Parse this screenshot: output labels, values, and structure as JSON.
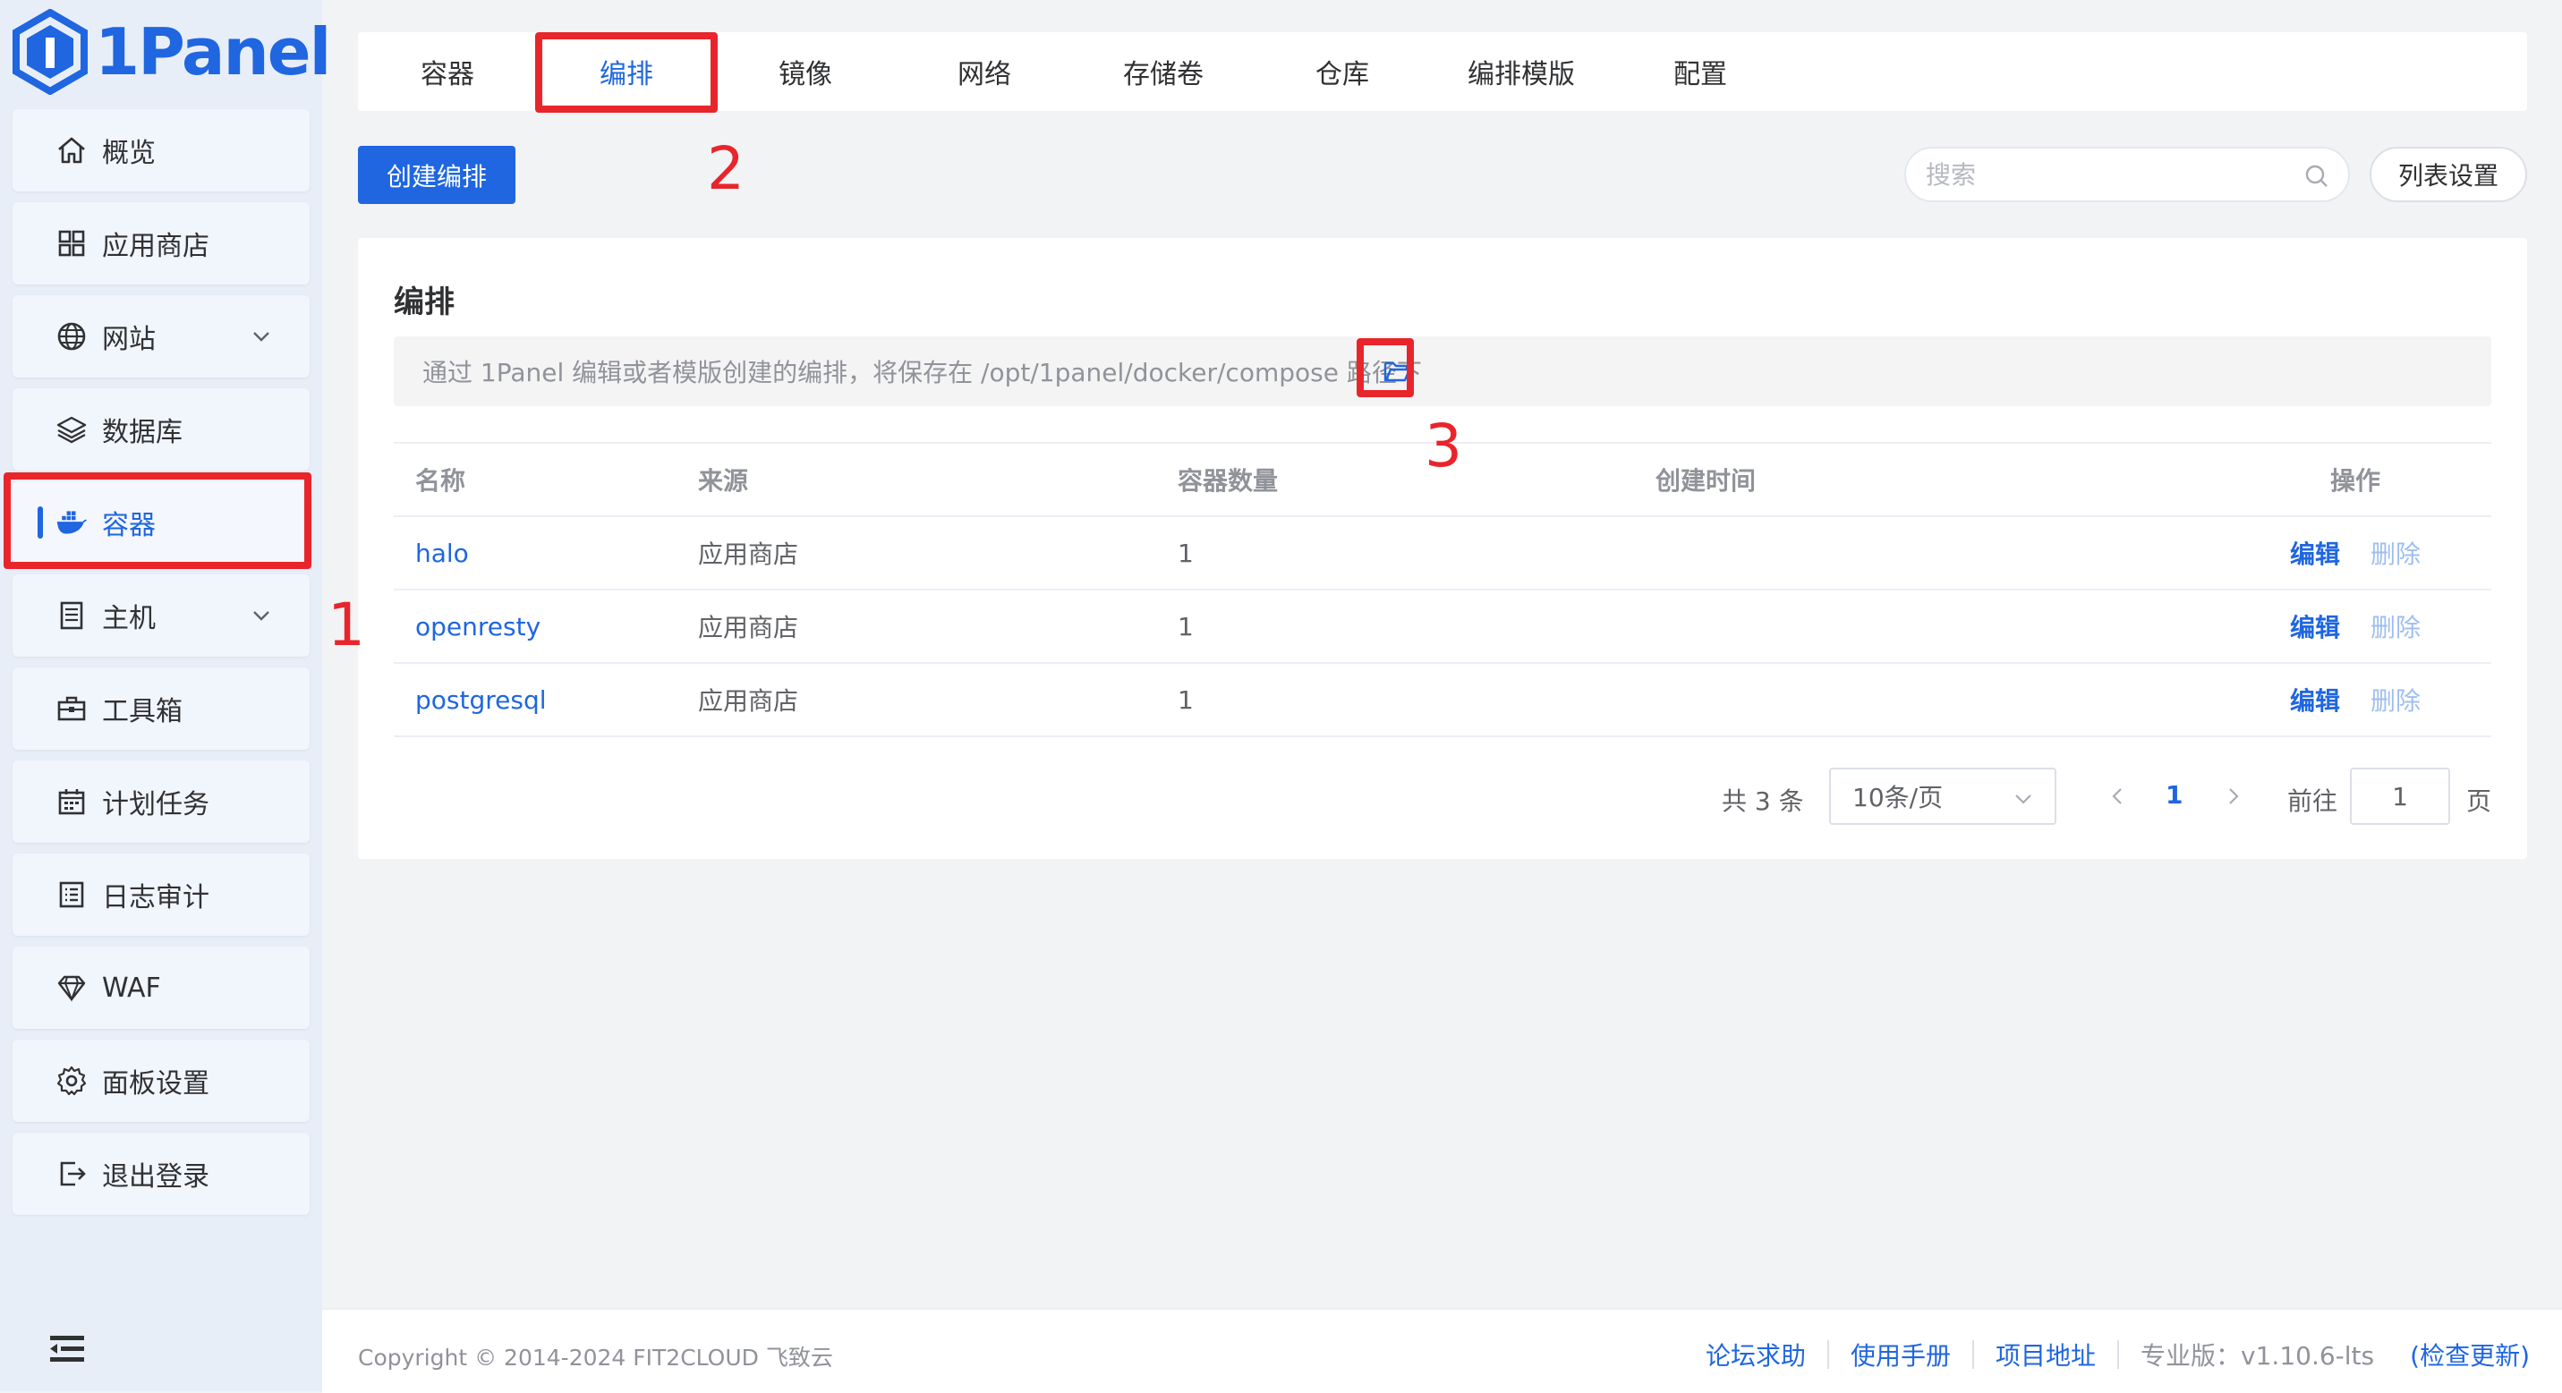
{
  "brand": {
    "name": "1Panel",
    "color": "#1f66e0"
  },
  "sidebar": {
    "items": [
      {
        "label": "概览",
        "icon": "home-icon"
      },
      {
        "label": "应用商店",
        "icon": "grid-icon"
      },
      {
        "label": "网站",
        "icon": "globe-icon",
        "expandable": true
      },
      {
        "label": "数据库",
        "icon": "layers-icon"
      },
      {
        "label": "容器",
        "icon": "docker-icon",
        "active": true
      },
      {
        "label": "主机",
        "icon": "server-icon",
        "expandable": true
      },
      {
        "label": "工具箱",
        "icon": "toolbox-icon"
      },
      {
        "label": "计划任务",
        "icon": "calendar-icon"
      },
      {
        "label": "日志审计",
        "icon": "log-icon"
      },
      {
        "label": "WAF",
        "icon": "diamond-icon"
      },
      {
        "label": "面板设置",
        "icon": "gear-icon"
      },
      {
        "label": "退出登录",
        "icon": "logout-icon"
      }
    ]
  },
  "tabs": [
    {
      "label": "容器"
    },
    {
      "label": "编排",
      "active": true
    },
    {
      "label": "镜像"
    },
    {
      "label": "网络"
    },
    {
      "label": "存储卷"
    },
    {
      "label": "仓库"
    },
    {
      "label": "编排模版"
    },
    {
      "label": "配置"
    }
  ],
  "toolbar": {
    "create_label": "创建编排",
    "search_placeholder": "搜索",
    "list_settings_label": "列表设置"
  },
  "card": {
    "title": "编排",
    "notice": "通过 1Panel 编辑或者模版创建的编排，将保存在 /opt/1panel/docker/compose 路径下"
  },
  "table": {
    "headers": [
      "名称",
      "来源",
      "容器数量",
      "创建时间",
      "操作"
    ],
    "rows": [
      {
        "name": "halo",
        "source": "应用商店",
        "count": "1",
        "created": ""
      },
      {
        "name": "openresty",
        "source": "应用商店",
        "count": "1",
        "created": ""
      },
      {
        "name": "postgresql",
        "source": "应用商店",
        "count": "1",
        "created": ""
      }
    ],
    "edit_label": "编辑",
    "delete_label": "删除"
  },
  "pagination": {
    "total": "共 3 条",
    "page_size": "10条/页",
    "current": "1",
    "goto_label": "前往",
    "goto_value": "1",
    "page_suffix": "页"
  },
  "footer": {
    "copyright": "Copyright © 2014-2024 FIT2CLOUD 飞致云",
    "links": [
      "论坛求助",
      "使用手册",
      "项目地址"
    ],
    "version": "专业版：v1.10.6-lts",
    "check_update": "(检查更新)"
  },
  "annotations": [
    "1",
    "2",
    "3"
  ],
  "colors": {
    "accent": "#1f66e0",
    "annotation": "#e8252b"
  }
}
